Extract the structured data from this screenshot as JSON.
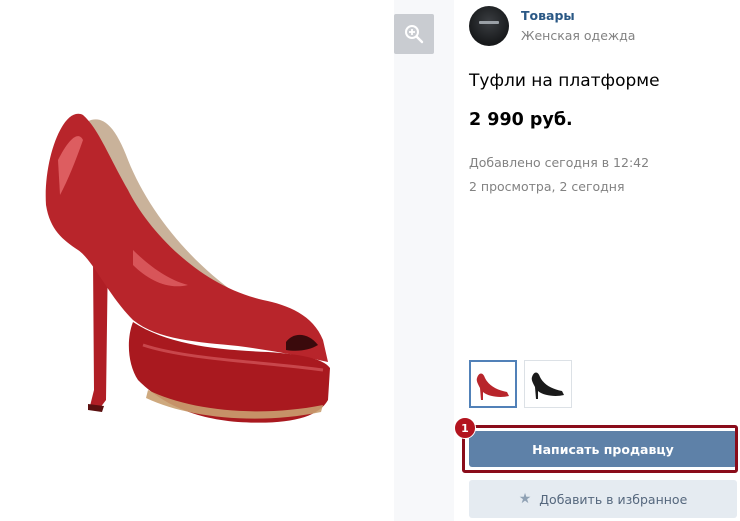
{
  "group": {
    "name": "Товары",
    "subtitle": "Женская одежда"
  },
  "product": {
    "title": "Туфли на платформе",
    "price": "2 990 руб.",
    "added": "Добавлено сегодня в 12:42",
    "views": "2 просмотра, 2 сегодня"
  },
  "thumbnails": [
    {
      "color": "red",
      "selected": true
    },
    {
      "color": "black",
      "selected": false
    }
  ],
  "buttons": {
    "write_seller": "Написать продавцу",
    "add_favorite": "Добавить в избранное"
  },
  "annotation": {
    "step": "1"
  },
  "colors": {
    "accent": "#5e81a8",
    "link": "#2a5885",
    "highlight": "#8a0c1a",
    "shoe_red": "#b8252b"
  }
}
